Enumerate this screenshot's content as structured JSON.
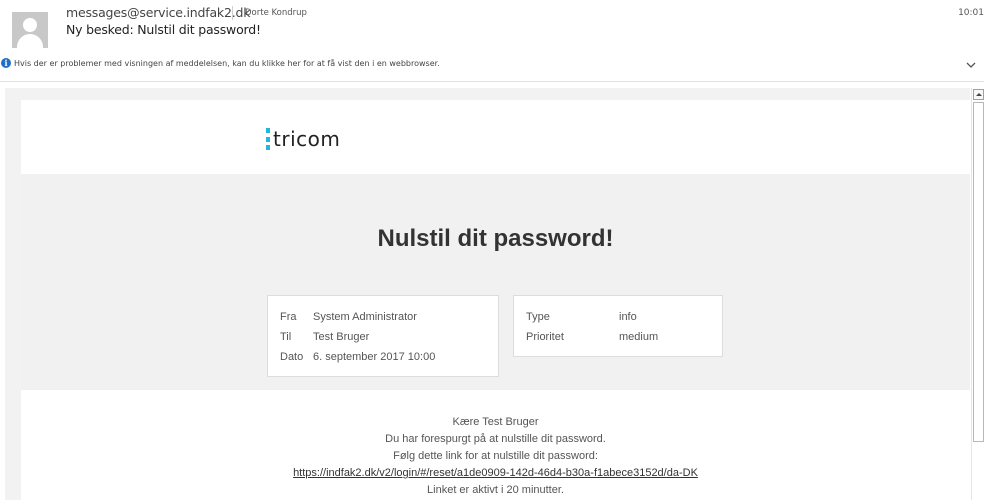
{
  "header": {
    "sender": "messages@service.indfak2.dk",
    "recipient": "Dorte Kondrup",
    "subject": "Ny besked: Nulstil dit password!",
    "time": "10:01",
    "info_message": "Hvis der er problemer med visningen af meddelelsen, kan du klikke her for at få vist den i en webbrowser.",
    "icons": {
      "avatar": "person-avatar-icon",
      "info": "info-icon",
      "expand": "chevron-down-icon"
    }
  },
  "email": {
    "logo_text": "tricom",
    "logo_color": "#23b7d9",
    "title": "Nulstil dit password!",
    "meta_left": [
      {
        "key": "Fra",
        "value": "System Administrator"
      },
      {
        "key": "Til",
        "value": "Test Bruger"
      },
      {
        "key": "Dato",
        "value": "6. september 2017 10:00"
      }
    ],
    "meta_right": [
      {
        "key": "Type",
        "value": "info"
      },
      {
        "key": "Prioritet",
        "value": "medium"
      }
    ],
    "body": {
      "greeting": "Kære Test Bruger",
      "line1": "Du har forespurgt på at nulstille dit password.",
      "line2": "Følg dette link for at nulstille dit password:",
      "link": "https://indfak2.dk/v2/login/#/reset/a1de0909-142d-46d4-b30a-f1abece3152d/da-DK",
      "line3": "Linket er aktivt i 20 minutter."
    }
  }
}
